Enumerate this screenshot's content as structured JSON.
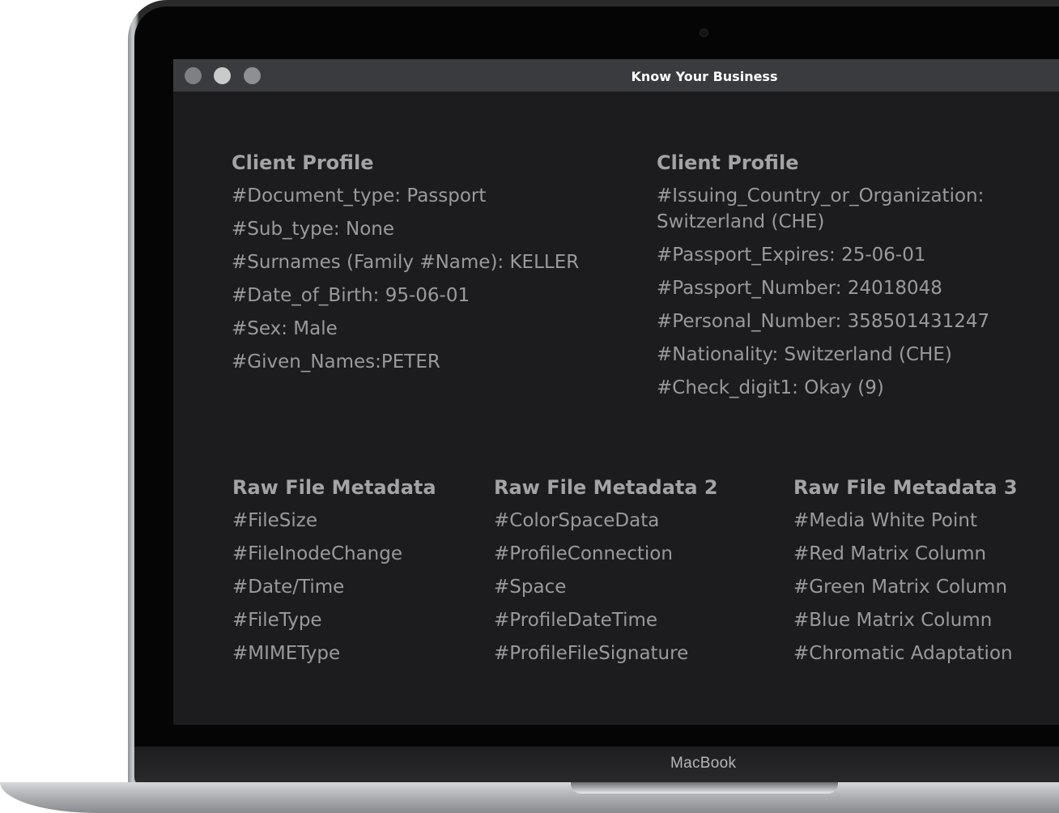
{
  "window": {
    "title": "Know Your Business"
  },
  "device": {
    "brand_label": "MacBook"
  },
  "client_profile_left": {
    "heading": "Client Profile",
    "items": [
      "#Document_type: Passport",
      "#Sub_type: None",
      "#Surnames (Family #Name): KELLER",
      "#Date_of_Birth: 95-06-01",
      "#Sex: Male",
      "#Given_Names:PETER"
    ]
  },
  "client_profile_right": {
    "heading": "Client Profile",
    "items": [
      "#Issuing_Country_or_Organization: Switzerland (CHE)",
      "#Passport_Expires: 25-06-01",
      "#Passport_Number: 24018048",
      "#Personal_Number: 358501431247",
      "#Nationality: Switzerland (CHE)",
      "#Check_digit1: Okay (9)"
    ]
  },
  "metadata_1": {
    "heading": "Raw File Metadata",
    "items": [
      "#FileSize",
      "#FileInodeChange",
      "#Date/Time",
      "#FileType",
      "#MIMEType"
    ]
  },
  "metadata_2": {
    "heading": "Raw File Metadata 2",
    "items": [
      "#ColorSpaceData",
      "#ProfileConnection",
      "#Space",
      "#ProfileDateTime",
      "#ProfileFileSignature"
    ]
  },
  "metadata_3": {
    "heading": "Raw File Metadata 3",
    "items": [
      "#Media White Point",
      "#Red Matrix Column",
      "#Green Matrix Column",
      "#Blue Matrix Column",
      "#Chromatic Adaptation"
    ]
  },
  "colors": {
    "window_background": "#1c1c1e",
    "titlebar": "#3a3b3e",
    "text": "#9a9a9c"
  }
}
